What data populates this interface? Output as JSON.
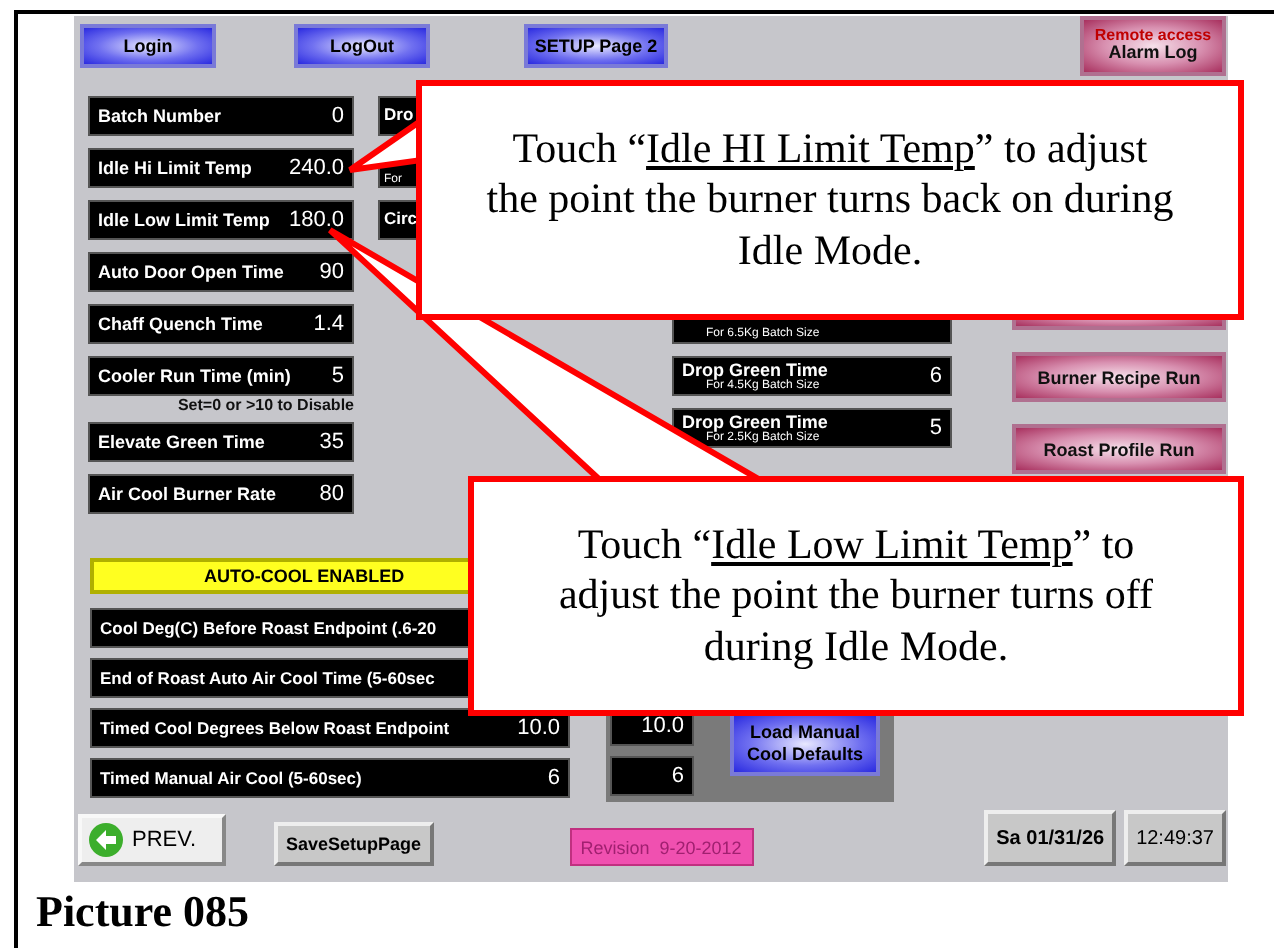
{
  "top_buttons": [
    {
      "label": "Login"
    },
    {
      "label": "LogOut"
    },
    {
      "label": "SETUP Page 2"
    }
  ],
  "alarm_button": {
    "caption": "Remote access",
    "label": "Alarm Log"
  },
  "settings": [
    {
      "label": "Batch Number",
      "value": "0"
    },
    {
      "label": "Idle Hi Limit Temp",
      "value": "240.0"
    },
    {
      "label": "Idle Low Limit Temp",
      "value": "180.0"
    },
    {
      "label": "Auto Door Open Time",
      "value": "90"
    },
    {
      "label": "Chaff Quench Time",
      "value": "1.4"
    },
    {
      "label": "Cooler Run Time (min)",
      "value": "5",
      "note": "Set=0 or >10 to Disable"
    },
    {
      "label": "Elevate Green Time",
      "value": "35"
    },
    {
      "label": "Air Cool Burner Rate",
      "value": "80"
    }
  ],
  "middle_fragments": [
    {
      "text": "Dro"
    },
    {
      "subtext": "For"
    },
    {
      "text": "Circ"
    }
  ],
  "drop_times": [
    {
      "subtitle": "For 6.5Kg Batch Size"
    },
    {
      "label": "Drop Green Time",
      "subtitle": "For 4.5Kg Batch Size",
      "value": "6"
    },
    {
      "label": "Drop Green Time",
      "subtitle": "For 2.5Kg Batch Size",
      "value": "5"
    }
  ],
  "right_buttons": [
    {
      "label": "Burner Recipe Run"
    },
    {
      "label": "Roast Profile Run"
    }
  ],
  "auto_cool": {
    "label": "AUTO-COOL ENABLED"
  },
  "cool_rows": [
    {
      "label": "Cool Deg(C) Before Roast Endpoint (.6-20"
    },
    {
      "label": "End of Roast Auto Air Cool Time (5-60sec"
    },
    {
      "label": "Timed Cool Degrees Below Roast Endpoint",
      "value": "10.0"
    },
    {
      "label": "Timed Manual Air Cool (5-60sec)",
      "value": "6"
    }
  ],
  "manual_cool_values": [
    "10.0",
    "6"
  ],
  "load_button": {
    "label": "Load Manual Cool Defaults"
  },
  "bottom_bar": {
    "prev": "PREV.",
    "save": "SaveSetupPage",
    "revision": "Revision  9-20-2012",
    "date": "Sa 01/31/26",
    "time": "12:49:37"
  },
  "callouts": [
    {
      "before": "Touch “",
      "underlined": "Idle HI Limit Temp",
      "after": "” to adjust the point the burner turns back on during Idle Mode."
    },
    {
      "before": "Touch “",
      "underlined": "Idle Low Limit Temp",
      "after": "” to adjust the point the burner turns off during Idle Mode."
    }
  ],
  "caption": "Picture 085"
}
